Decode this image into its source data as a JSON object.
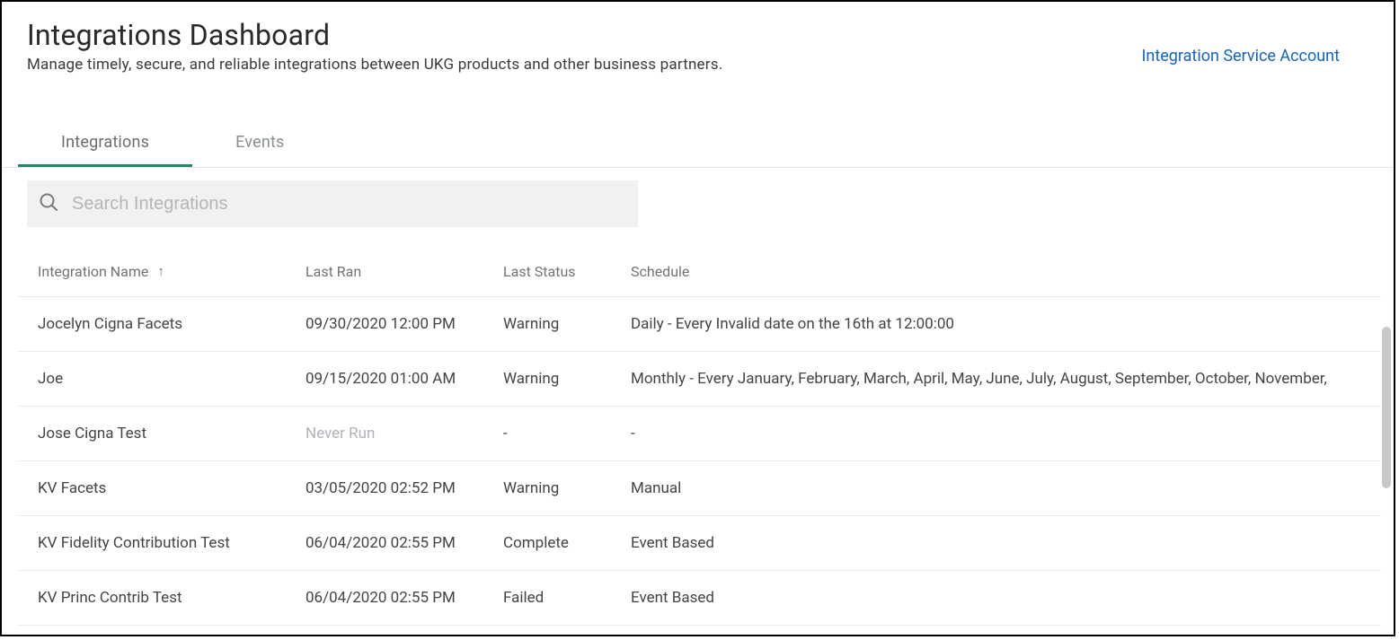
{
  "header": {
    "title": "Integrations Dashboard",
    "subtitle": "Manage timely, secure, and reliable integrations between UKG products and other business partners.",
    "top_link": "Integration Service Account"
  },
  "tabs": [
    {
      "label": "Integrations",
      "active": true
    },
    {
      "label": "Events",
      "active": false
    }
  ],
  "search": {
    "placeholder": "Search Integrations",
    "value": ""
  },
  "table": {
    "columns": [
      {
        "key": "name",
        "label": "Integration Name",
        "sorted": "asc"
      },
      {
        "key": "last_ran",
        "label": "Last Ran"
      },
      {
        "key": "status",
        "label": "Last Status"
      },
      {
        "key": "schedule",
        "label": "Schedule"
      }
    ],
    "rows": [
      {
        "name": "Jocelyn Cigna Facets",
        "last_ran": "09/30/2020 12:00 PM",
        "last_ran_muted": false,
        "status": "Warning",
        "schedule": "Daily - Every Invalid date on the 16th at 12:00:00"
      },
      {
        "name": "Joe",
        "last_ran": "09/15/2020 01:00 AM",
        "last_ran_muted": false,
        "status": "Warning",
        "schedule": "Monthly - Every January, February, March, April, May, June, July, August, September, October, November,"
      },
      {
        "name": "Jose Cigna Test",
        "last_ran": "Never Run",
        "last_ran_muted": true,
        "status": "-",
        "schedule": "-"
      },
      {
        "name": "KV Facets",
        "last_ran": "03/05/2020 02:52 PM",
        "last_ran_muted": false,
        "status": "Warning",
        "schedule": "Manual"
      },
      {
        "name": "KV Fidelity Contribution Test",
        "last_ran": "06/04/2020 02:55 PM",
        "last_ran_muted": false,
        "status": "Complete",
        "schedule": "Event Based"
      },
      {
        "name": "KV Princ Contrib Test",
        "last_ran": "06/04/2020 02:55 PM",
        "last_ran_muted": false,
        "status": "Failed",
        "schedule": "Event Based"
      }
    ]
  },
  "sort_arrow_glyph": "↑"
}
